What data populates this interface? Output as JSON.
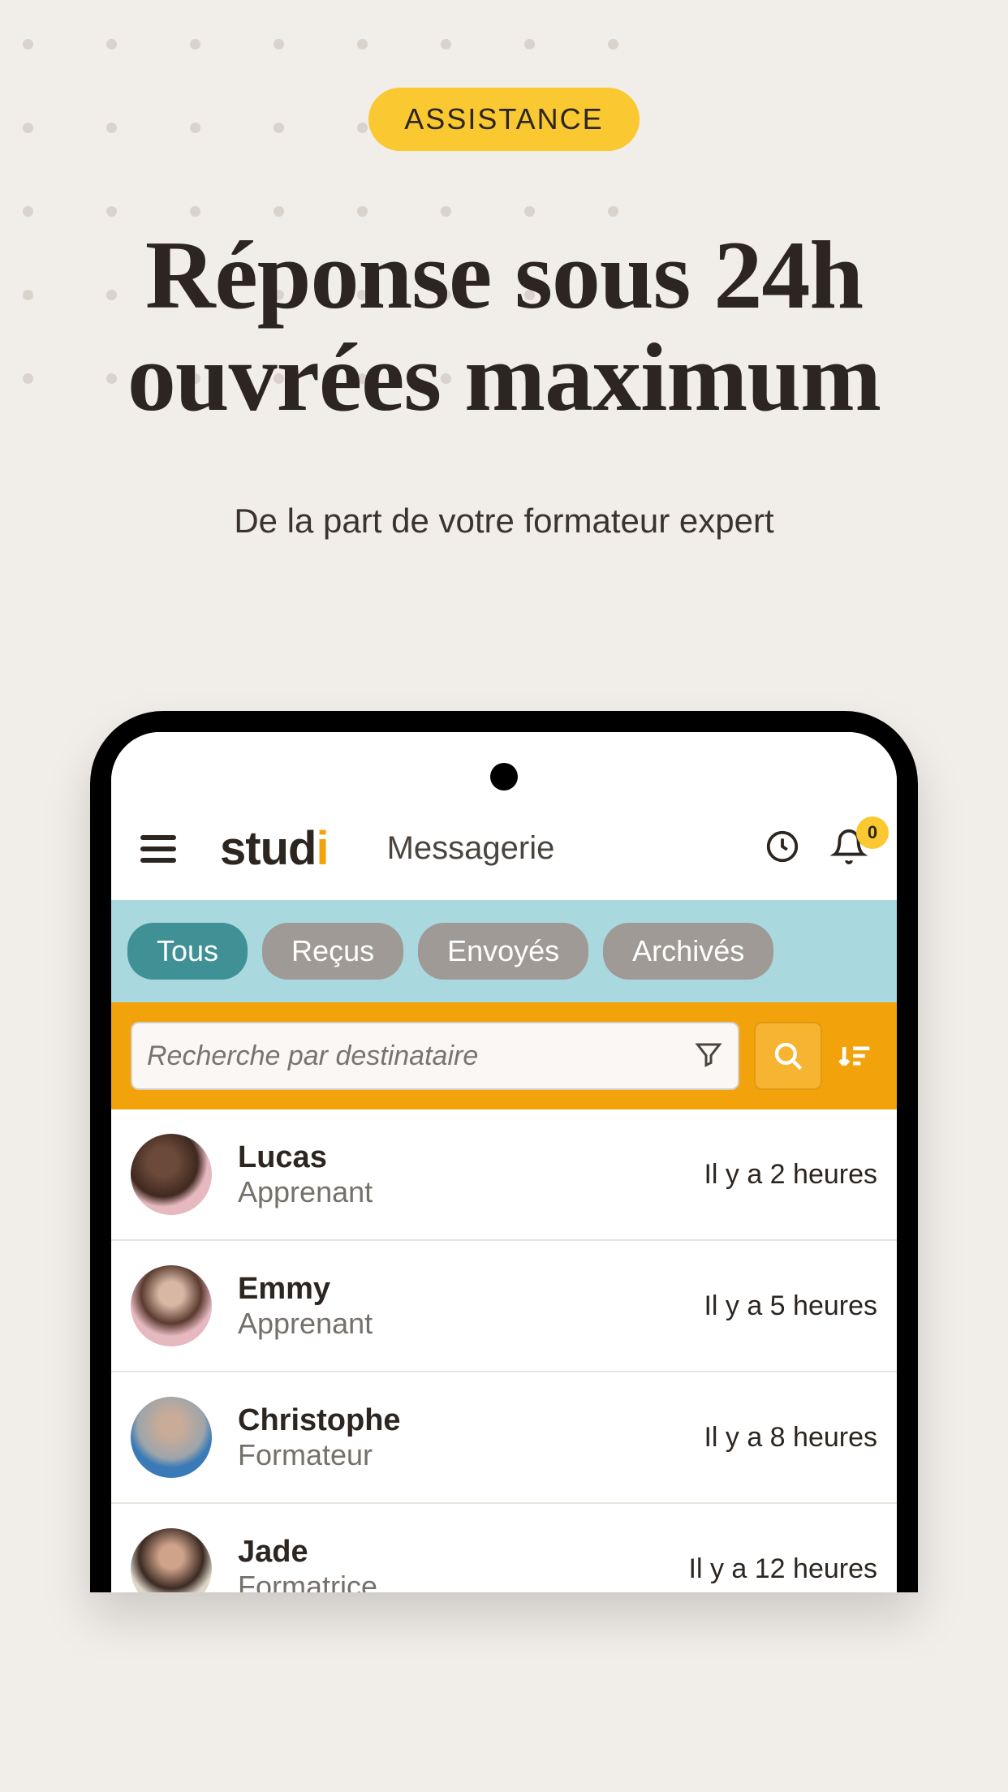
{
  "hero": {
    "badge": "ASSISTANCE",
    "title": "Réponse sous 24h ouvrées maximum",
    "subtitle": "De la part de votre formateur expert"
  },
  "app": {
    "logo_start": "stud",
    "logo_accent": "i",
    "screen_title": "Messagerie",
    "notification_count": "0"
  },
  "tabs": {
    "items": [
      {
        "label": "Tous",
        "active": true
      },
      {
        "label": "Reçus",
        "active": false
      },
      {
        "label": "Envoyés",
        "active": false
      },
      {
        "label": "Archivés",
        "active": false
      }
    ]
  },
  "search": {
    "placeholder": "Recherche par destinataire"
  },
  "messages": {
    "items": [
      {
        "name": "Lucas",
        "role": "Apprenant",
        "time": "Il y a 2 heures"
      },
      {
        "name": "Emmy",
        "role": "Apprenant",
        "time": "Il y a 5 heures"
      },
      {
        "name": "Christophe",
        "role": "Formateur",
        "time": "Il y a 8 heures"
      },
      {
        "name": "Jade",
        "role": "Formatrice",
        "time": "Il y a 12 heures"
      }
    ]
  }
}
